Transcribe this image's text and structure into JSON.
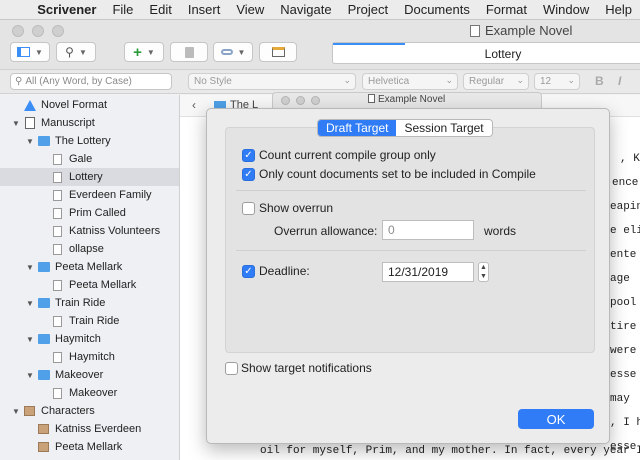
{
  "menubar": {
    "apple_glyph": "",
    "app_name": "Scrivener",
    "items": [
      "File",
      "Edit",
      "Insert",
      "View",
      "Navigate",
      "Project",
      "Documents",
      "Format",
      "Window",
      "Help"
    ]
  },
  "window": {
    "title": "Example Novel"
  },
  "toolbar": {
    "add_glyph": "+",
    "search_glyph": "⚲",
    "tab_title": "Lottery"
  },
  "formatbar": {
    "search_placeholder": "All (Any Word, by Case)",
    "style": "No Style",
    "font": "Helvetica",
    "weight": "Regular",
    "size": "12",
    "bold": "B",
    "italic": "I"
  },
  "binder": {
    "items": [
      {
        "label": "Novel Format"
      },
      {
        "label": "Manuscript"
      },
      {
        "label": "The Lottery"
      },
      {
        "label": "Gale"
      },
      {
        "label": "Lottery"
      },
      {
        "label": "Everdeen Family"
      },
      {
        "label": "Prim Called"
      },
      {
        "label": "Katniss Volunteers"
      },
      {
        "label": "ollapse"
      },
      {
        "label": "Peeta Mellark"
      },
      {
        "label": "Peeta Mellark"
      },
      {
        "label": "Train Ride"
      },
      {
        "label": "Train Ride"
      },
      {
        "label": "Haymitch"
      },
      {
        "label": "Haymitch"
      },
      {
        "label": "Makeover"
      },
      {
        "label": "Makeover"
      },
      {
        "label": "Characters"
      },
      {
        "label": "Katniss Everdeen"
      },
      {
        "label": "Peeta Mellark"
      }
    ]
  },
  "editor": {
    "breadcrumb": "The L",
    "lines": [
      ", Kat",
      "ence.",
      "eapin",
      "e eli",
      "ente",
      "age",
      "pool",
      "tire",
      "were",
      "esse",
      "may",
      ", I h",
      "esse"
    ],
    "bottom_line": "oil for myself, Prim, and my mother. In fact, every year I h"
  },
  "dialog": {
    "window_title": "Example Novel",
    "tabs": [
      "Draft Target",
      "Session Target"
    ],
    "count_compile_group": "Count current compile group only",
    "count_included": "Only count documents set to be included in Compile",
    "show_overrun": "Show overrun",
    "overrun_label": "Overrun allowance:",
    "overrun_value": "0",
    "overrun_unit": "words",
    "deadline_label": "Deadline:",
    "deadline_value": "12/31/2019",
    "notifications": "Show target notifications",
    "ok": "OK",
    "accent_color": "#2f7cf6"
  }
}
